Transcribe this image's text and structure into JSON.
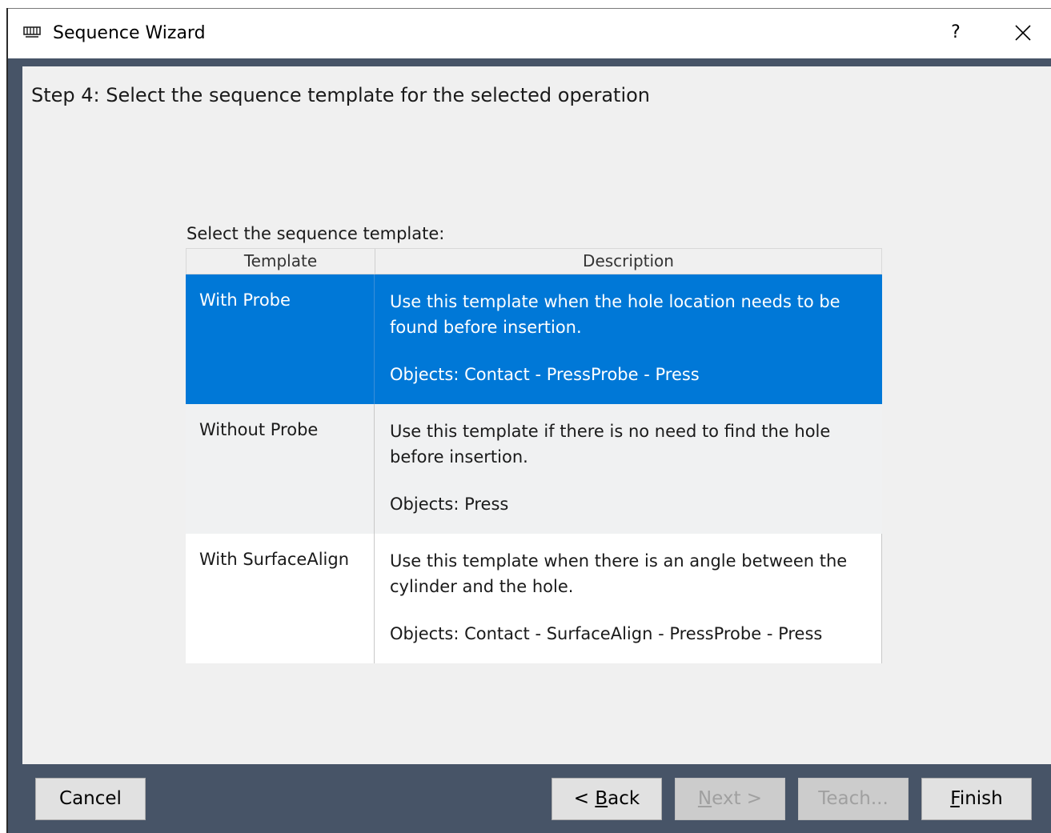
{
  "window": {
    "title": "Sequence Wizard",
    "icon": "wizard-app-icon",
    "help_label": "?",
    "close_icon": "close-icon"
  },
  "step": {
    "title": "Step 4: Select the sequence template for the selected operation"
  },
  "templates": {
    "label": "Select the sequence template:",
    "columns": [
      "Template",
      "Description"
    ],
    "rows": [
      {
        "name": "With Probe",
        "description": "Use this template when the hole location needs to be found before insertion.",
        "objects": "Objects: Contact - PressProbe - Press",
        "selected": true
      },
      {
        "name": "Without Probe",
        "description": "Use this template if there is no need to find the hole before insertion.",
        "objects": "Objects: Press",
        "selected": false
      },
      {
        "name": "With SurfaceAlign",
        "description": "Use this template when there is an angle between the cylinder and the hole.",
        "objects": "Objects: Contact - SurfaceAlign - PressProbe - Press",
        "selected": false
      }
    ]
  },
  "footer": {
    "cancel": "Cancel",
    "back": {
      "prefix": "< ",
      "mnemonic": "B",
      "rest": "ack"
    },
    "next": {
      "mnemonic": "N",
      "rest": "ext >",
      "enabled": false
    },
    "teach": {
      "label": "Teach...",
      "enabled": false
    },
    "finish": {
      "mnemonic": "F",
      "rest": "inish"
    }
  },
  "colors": {
    "frame": "#475467",
    "selection": "#0078d7",
    "content_bg": "#f0f0f0"
  }
}
